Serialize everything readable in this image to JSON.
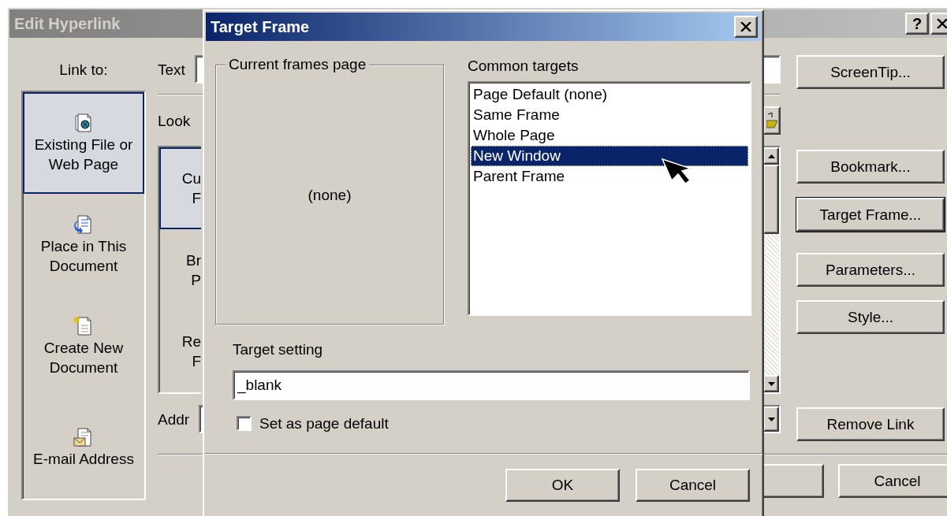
{
  "edit_hyperlink": {
    "title": "Edit Hyperlink",
    "help_button": "?",
    "link_to": {
      "label": "Link to:",
      "items": [
        {
          "kind": "web",
          "lines": [
            "Existing File or",
            "Web Page"
          ],
          "selected": true
        },
        {
          "kind": "place",
          "lines": [
            "Place in This",
            "Document"
          ],
          "selected": false
        },
        {
          "kind": "new",
          "lines": [
            "Create New",
            "Document"
          ],
          "selected": false
        },
        {
          "kind": "email",
          "lines": [
            "E-mail Address"
          ],
          "selected": false
        }
      ]
    },
    "text_label": "Text",
    "look_label": "Look",
    "look_items": [
      {
        "lines": [
          "Cu",
          "F"
        ],
        "selected": true
      },
      {
        "lines": [
          "Br",
          "P"
        ],
        "selected": false
      },
      {
        "lines": [
          "Re",
          "F"
        ],
        "selected": false
      }
    ],
    "address_label": "Addr",
    "buttons": [
      {
        "label": "ScreenTip...",
        "default": false
      },
      {
        "label": "Bookmark...",
        "default": false
      },
      {
        "label": "Target Frame...",
        "default": true
      },
      {
        "label": "Parameters...",
        "default": false
      },
      {
        "label": "Style...",
        "default": false
      },
      {
        "label": "Remove Link",
        "default": false
      }
    ],
    "cancel": "Cancel"
  },
  "target_frame": {
    "title": "Target Frame",
    "current_frames": {
      "legend": "Current frames page",
      "content": "(none)"
    },
    "common_targets": {
      "label": "Common targets",
      "items": [
        {
          "label": "Page Default (none)",
          "selected": false
        },
        {
          "label": "Same Frame",
          "selected": false
        },
        {
          "label": "Whole Page",
          "selected": false
        },
        {
          "label": "New Window",
          "selected": true
        },
        {
          "label": "Parent Frame",
          "selected": false
        }
      ]
    },
    "target_setting": {
      "label": "Target setting",
      "value": "_blank"
    },
    "set_as_default": {
      "label": "Set as page default",
      "checked": false
    },
    "buttons": [
      "OK",
      "Cancel"
    ]
  }
}
